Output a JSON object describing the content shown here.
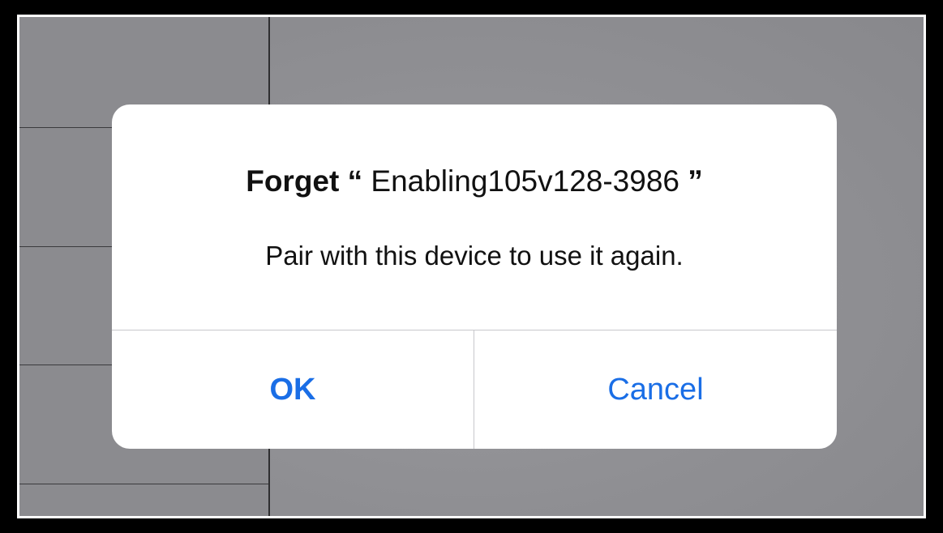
{
  "alert": {
    "title_prefix": "Forget",
    "open_quote": "“",
    "device_name": "Enabling105v128-3986",
    "close_quote": "”",
    "message": "Pair with this device to use it again.",
    "ok_label": "OK",
    "cancel_label": "Cancel"
  },
  "colors": {
    "button_text": "#1a6ee6",
    "dialog_background": "#ffffff",
    "dimmed_background": "#8e8e92"
  }
}
